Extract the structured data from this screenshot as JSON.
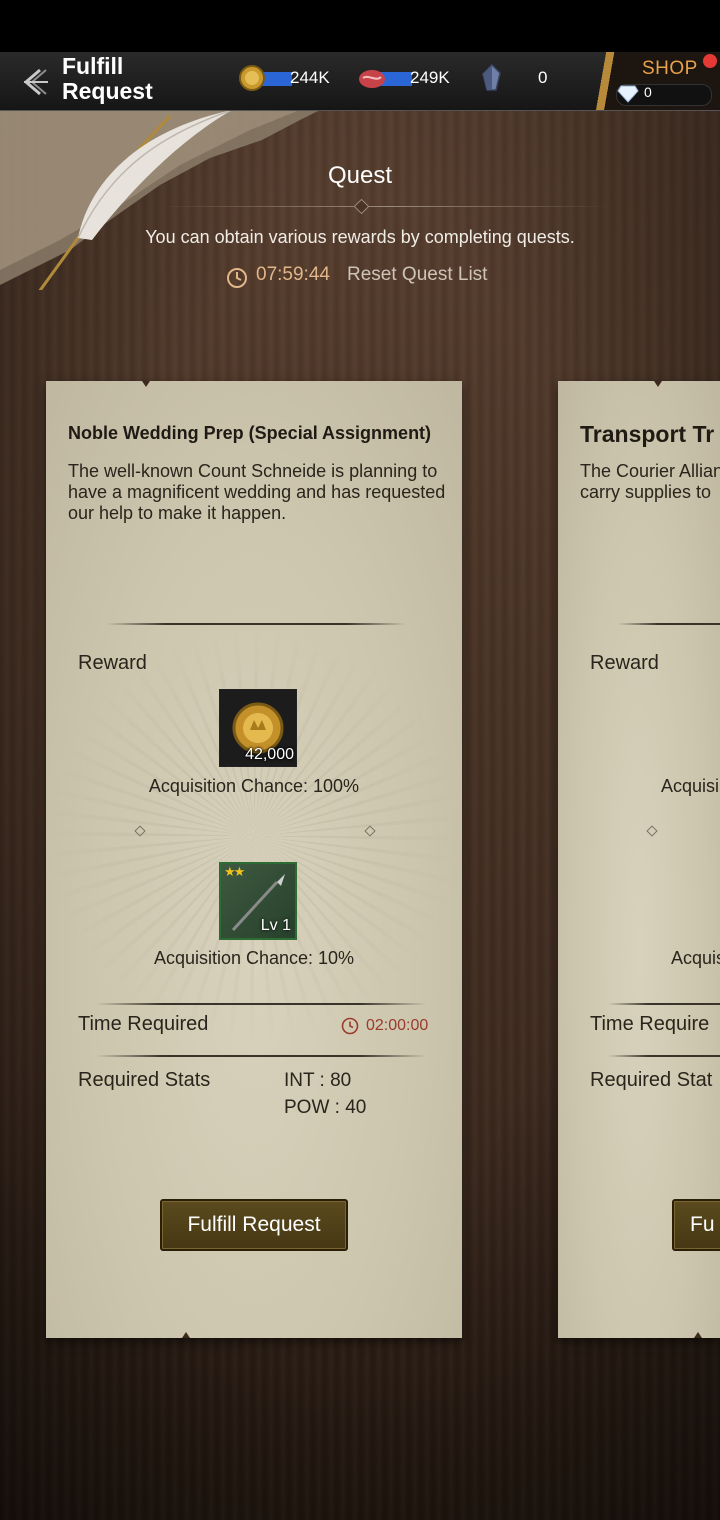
{
  "header": {
    "title_line1": "Fulfill",
    "title_line2": "Request",
    "resources": {
      "gold": "244K",
      "meat": "249K",
      "crystal": "0"
    },
    "shop_label": "SHOP",
    "gems": "0"
  },
  "quest": {
    "title": "Quest",
    "description": "You can obtain various rewards by completing quests.",
    "timer": "07:59:44",
    "reset_label": "Reset Quest List"
  },
  "cards": [
    {
      "name": "Noble Wedding Prep (Special Assignment)",
      "description": "The well-known Count Schneide is planning to have a magnificent wedding and has requested our help to make it happen.",
      "reward_label": "Reward",
      "rewards": [
        {
          "icon": "gold-coin-icon",
          "quantity": "42,000",
          "chance": "Acquisition Chance: 100%"
        },
        {
          "icon": "spear-icon",
          "stars": "★★",
          "level": "Lv 1",
          "chance": "Acquisition Chance: 10%"
        }
      ],
      "time_label": "Time Required",
      "time_value": "02:00:00",
      "stats_label": "Required Stats",
      "stats": [
        "INT : 80",
        "POW : 40"
      ],
      "button": "Fulfill Request"
    },
    {
      "name": "Transport Tr",
      "description_line1": "The Courier Allian",
      "description_line2": "carry supplies to",
      "reward_label": "Reward",
      "chance1": "Acquisi",
      "chance2": "Acquis",
      "time_label": "Time Require",
      "stats_label": "Required Stat",
      "button": "Fu"
    }
  ],
  "colors": {
    "accent_gold": "#e2b58a",
    "time_red": "#9a3b2c",
    "shop_orange": "#e8a24a",
    "button_brown": "#4f4018"
  }
}
